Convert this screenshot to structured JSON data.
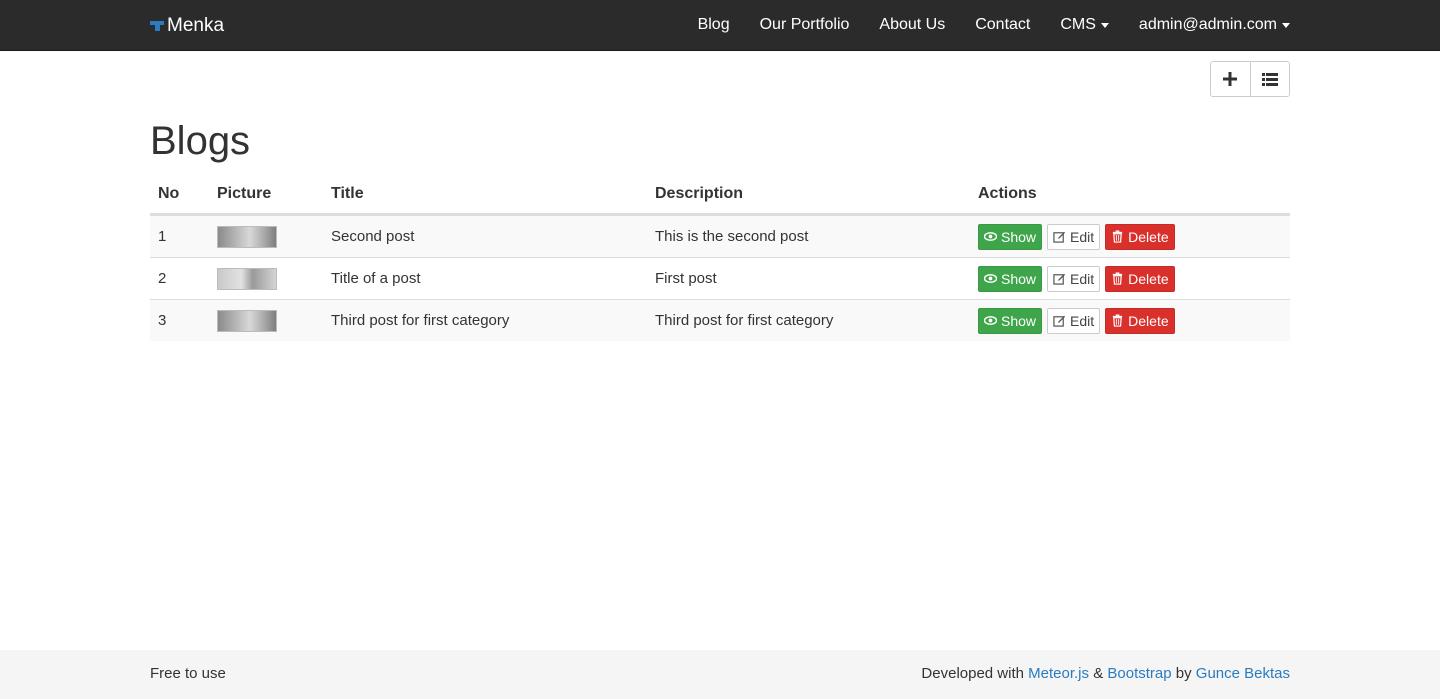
{
  "navbar": {
    "brand": "Menka",
    "links": [
      "Blog",
      "Our Portfolio",
      "About Us",
      "Contact"
    ],
    "cms_label": "CMS",
    "user_label": "admin@admin.com"
  },
  "toolbar": {
    "add_icon": "plus-icon",
    "list_icon": "list-icon"
  },
  "page": {
    "title": "Blogs"
  },
  "table": {
    "headers": [
      "No",
      "Picture",
      "Title",
      "Description",
      "Actions"
    ],
    "rows": [
      {
        "no": "1",
        "title": "Second post",
        "description": "This is the second post"
      },
      {
        "no": "2",
        "title": "Title of a post",
        "description": "First post"
      },
      {
        "no": "3",
        "title": "Third post for first category",
        "description": "Third post for first category"
      }
    ],
    "actions": {
      "show": "Show",
      "edit": "Edit",
      "delete": "Delete"
    }
  },
  "footer": {
    "left": "Free to use",
    "developed_with": "Developed with",
    "meteor": "Meteor.js",
    "amp": "&",
    "bootstrap": "Bootstrap",
    "by": "by",
    "author": "Gunce Bektas"
  },
  "colors": {
    "navbar_bg": "#2b2b2b",
    "brand_accent": "#2a7bbf",
    "show_green": "#3fa54a",
    "delete_red": "#d9302c",
    "link_blue": "#2a7bbf"
  }
}
